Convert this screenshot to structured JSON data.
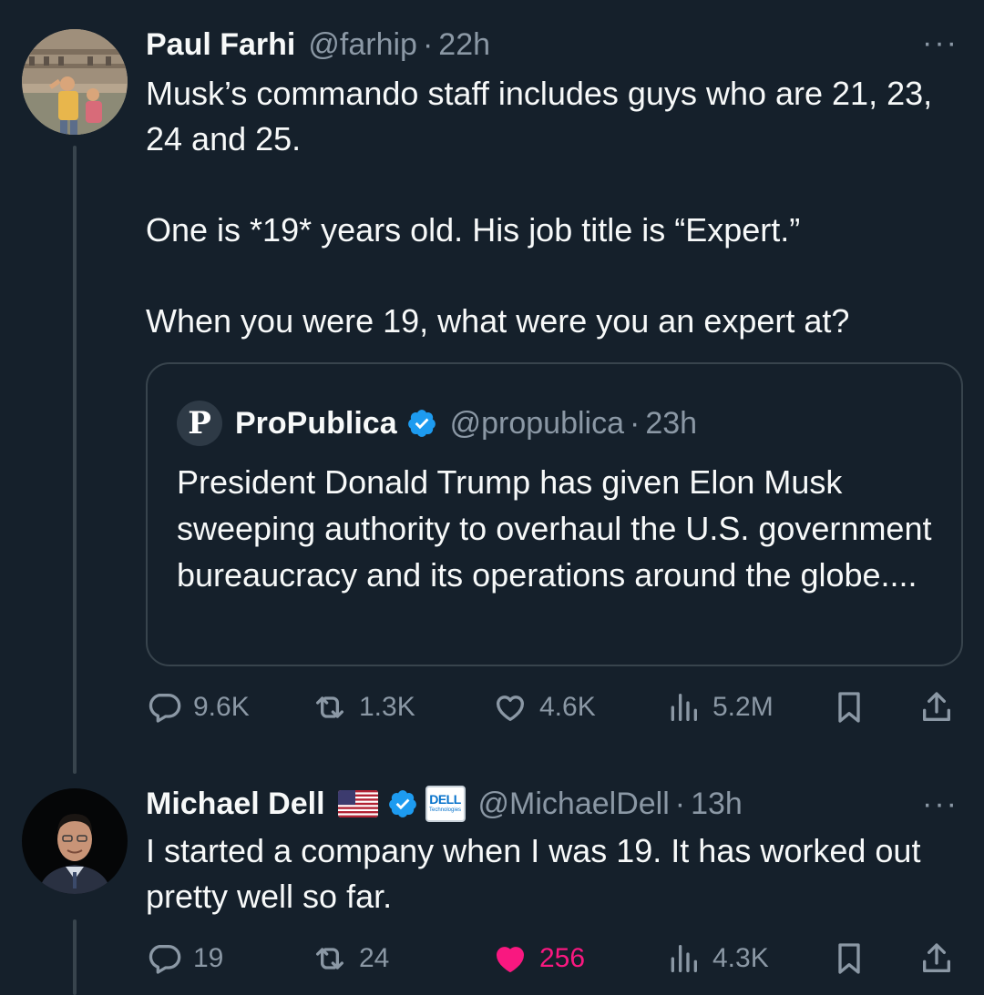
{
  "tweets": [
    {
      "author": "Paul Farhi",
      "handle": "@farhip",
      "separator": "·",
      "time": "22h",
      "more": "···",
      "text": [
        "Musk’s commando staff includes guys who are 21, 23, 24 and 25.",
        "One is *19* years old. His job title is “Expert.”",
        "When you were 19, what were you an expert at?"
      ],
      "quote": {
        "logo": "P",
        "author": "ProPublica",
        "handle": "@propublica",
        "separator": "·",
        "time": "23h",
        "text": "President Donald Trump has given Elon Musk sweeping authority to overhaul the U.S. government bureaucracy and its operations around the globe...."
      },
      "stats": {
        "replies": "9.6K",
        "reposts": "1.3K",
        "likes": "4.6K",
        "views": "5.2M"
      }
    },
    {
      "author": "Michael Dell",
      "badge_text": "DELL",
      "badge_sub": "Technologies",
      "handle": "@MichaelDell",
      "separator": "·",
      "time": "13h",
      "more": "···",
      "text": "I started a company when I was 19. It has worked out pretty well so far.",
      "stats": {
        "replies": "19",
        "reposts": "24",
        "likes": "256",
        "views": "4.3K"
      }
    }
  ],
  "icons": [
    "reply-icon",
    "repost-icon",
    "like-icon",
    "views-icon",
    "bookmark-icon",
    "share-icon",
    "verified-icon",
    "us-flag-icon",
    "more-icon"
  ],
  "colors": {
    "background": "#15202b",
    "text": "#f7f9f9",
    "muted": "#8b98a5",
    "border": "#38444d",
    "verified": "#1d9bf0",
    "like": "#f91880"
  }
}
